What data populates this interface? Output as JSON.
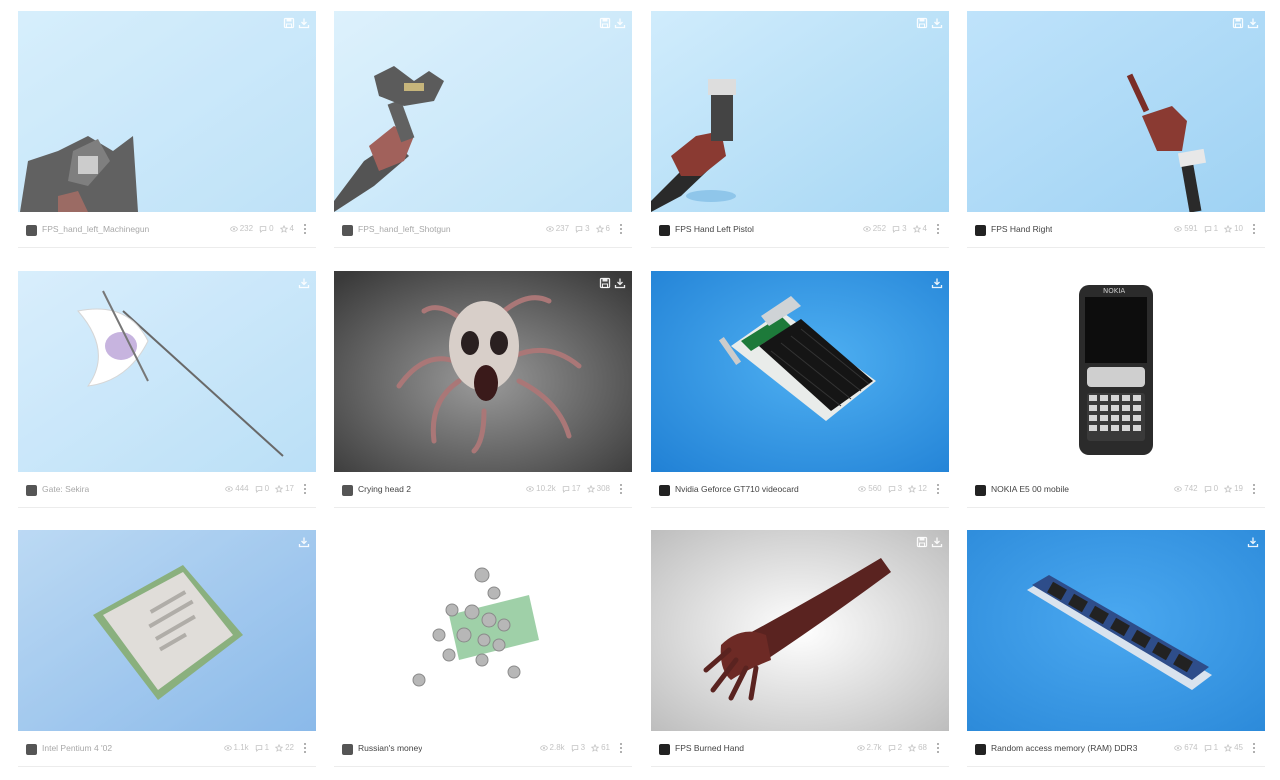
{
  "cards": [
    {
      "title": "FPS_hand_left_Machinegun",
      "views": "232",
      "comments": "0",
      "likes": "4",
      "icons": [
        "save-icon",
        "download-icon"
      ],
      "avatar_color": "#555555",
      "faded": true
    },
    {
      "title": "FPS_hand_left_Shotgun",
      "views": "237",
      "comments": "3",
      "likes": "6",
      "icons": [
        "save-icon",
        "download-icon"
      ],
      "avatar_color": "#555555",
      "faded": true
    },
    {
      "title": "FPS Hand Left Pistol",
      "views": "252",
      "comments": "3",
      "likes": "4",
      "icons": [
        "save-icon",
        "download-icon"
      ],
      "avatar_color": "#222222",
      "faded": false
    },
    {
      "title": "FPS Hand Right",
      "views": "591",
      "comments": "1",
      "likes": "10",
      "icons": [
        "save-icon",
        "download-icon"
      ],
      "avatar_color": "#222222",
      "faded": false
    },
    {
      "title": "Gate: Sekira",
      "views": "444",
      "comments": "0",
      "likes": "17",
      "icons": [
        "download-icon"
      ],
      "avatar_color": "#555555",
      "faded": true
    },
    {
      "title": "Crying head 2",
      "views": "10.2k",
      "comments": "17",
      "likes": "308",
      "icons": [
        "save-icon",
        "download-icon"
      ],
      "avatar_color": "#555555",
      "faded": false
    },
    {
      "title": "Nvidia Geforce GT710 videocard",
      "views": "560",
      "comments": "3",
      "likes": "12",
      "icons": [
        "download-icon"
      ],
      "avatar_color": "#222222",
      "faded": false
    },
    {
      "title": "NOKIA E5 00 mobile",
      "views": "742",
      "comments": "0",
      "likes": "19",
      "icons": [],
      "avatar_color": "#222222",
      "faded": false
    },
    {
      "title": "Intel Pentium 4 '02",
      "views": "1.1k",
      "comments": "1",
      "likes": "22",
      "icons": [
        "download-icon"
      ],
      "avatar_color": "#555555",
      "faded": true
    },
    {
      "title": "Russian's money",
      "views": "2.8k",
      "comments": "3",
      "likes": "61",
      "icons": [],
      "avatar_color": "#555555",
      "faded": false
    },
    {
      "title": "FPS Burned Hand",
      "views": "2.7k",
      "comments": "2",
      "likes": "68",
      "icons": [
        "save-icon",
        "download-icon"
      ],
      "avatar_color": "#222222",
      "faded": false
    },
    {
      "title": "Random access memory (RAM) DDR3",
      "views": "674",
      "comments": "1",
      "likes": "45",
      "icons": [
        "download-icon"
      ],
      "avatar_color": "#222222",
      "faded": false
    }
  ],
  "colors": {
    "sky_light": "#bfe3f8",
    "sky_blue": "#2f8fe0",
    "muted_stats": "#c4c4c4"
  }
}
